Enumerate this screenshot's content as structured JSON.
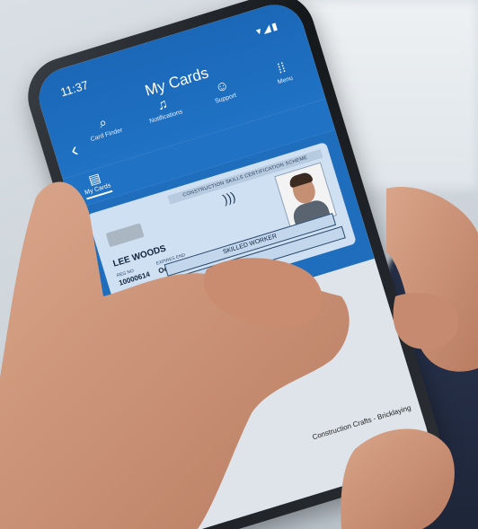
{
  "status": {
    "time": "11:37",
    "icons": "▾◢▮"
  },
  "app": {
    "title": "My Cards"
  },
  "nav": {
    "items": [
      {
        "label": "Card Finder",
        "icon": "search-icon"
      },
      {
        "label": "Notifications",
        "icon": "bell-icon"
      },
      {
        "label": "Support",
        "icon": "support-icon"
      },
      {
        "label": "Menu",
        "icon": "grid-icon"
      }
    ]
  },
  "subnav": {
    "label": "My Cards",
    "icon": "card-icon"
  },
  "card": {
    "scheme": "CONSTRUCTION SKILLS CERTIFICATION SCHEME",
    "name": "LEE WOODS",
    "reg_label": "REG NO",
    "expiry_label": "EXPIRES END",
    "reg_no": "10000614",
    "expiry": "Oct 2025",
    "role": "SKILLED WORKER"
  },
  "footer": {
    "text": "Construction Crafts - Bricklaying"
  },
  "colors": {
    "brand_blue": "#1f72c4",
    "card_bg": "#cfe0f2"
  }
}
